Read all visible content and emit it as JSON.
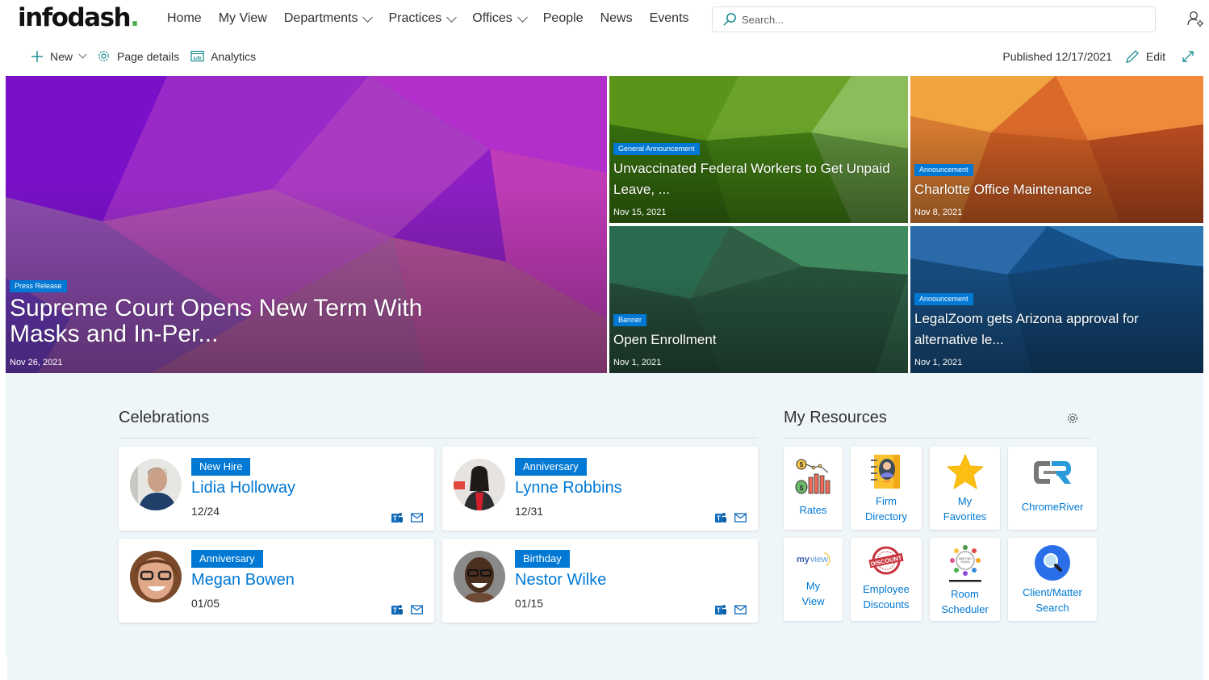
{
  "brand": {
    "logo_text": "infodash",
    "logo_dot": ".",
    "accent": "#4caf50"
  },
  "nav": {
    "items": [
      {
        "label": "Home",
        "dropdown": false
      },
      {
        "label": "My View",
        "dropdown": false
      },
      {
        "label": "Departments",
        "dropdown": true
      },
      {
        "label": "Practices",
        "dropdown": true
      },
      {
        "label": "Offices",
        "dropdown": true
      },
      {
        "label": "People",
        "dropdown": false
      },
      {
        "label": "News",
        "dropdown": false
      },
      {
        "label": "Events",
        "dropdown": false
      }
    ],
    "search_placeholder": "Search...",
    "user_icon": "person-settings-icon"
  },
  "commandbar": {
    "new_label": "New",
    "page_details_label": "Page details",
    "analytics_label": "Analytics",
    "published": "Published 12/17/2021",
    "edit_label": "Edit"
  },
  "hero": {
    "tiles": [
      {
        "badge": "Press Release",
        "title": "Supreme Court Opens New Term With Masks and In-Per...",
        "date": "Nov 26, 2021",
        "theme": "purple"
      },
      {
        "badge": "General Announcement",
        "title": "Unvaccinated Federal Workers to Get Unpaid Leave, ...",
        "date": "Nov 15, 2021",
        "theme": "green"
      },
      {
        "badge": "Announcement",
        "title": "Charlotte Office Maintenance",
        "date": "Nov 8, 2021",
        "theme": "orange"
      },
      {
        "badge": "Banner",
        "title": "Open Enrollment",
        "date": "Nov 1, 2021",
        "theme": "teal"
      },
      {
        "badge": "Announcement",
        "title": "LegalZoom gets Arizona approval for alternative le...",
        "date": "Nov 1, 2021",
        "theme": "blue"
      }
    ]
  },
  "celebrations": {
    "title": "Celebrations",
    "items": [
      {
        "type": "New Hire",
        "name": "Lidia Holloway",
        "date": "12/24"
      },
      {
        "type": "Anniversary",
        "name": "Lynne Robbins",
        "date": "12/31"
      },
      {
        "type": "Anniversary",
        "name": "Megan Bowen",
        "date": "01/05"
      },
      {
        "type": "Birthday",
        "name": "Nestor Wilke",
        "date": "01/15"
      }
    ]
  },
  "resources": {
    "title": "My Resources",
    "items": [
      {
        "label_1": "Rates",
        "label_2": "",
        "icon": "rates-chart-icon"
      },
      {
        "label_1": "Firm",
        "label_2": "Directory",
        "icon": "directory-book-icon"
      },
      {
        "label_1": "My",
        "label_2": "Favorites",
        "icon": "star-icon"
      },
      {
        "label_1": "ChromeRiver",
        "label_2": "",
        "icon": "chromeriver-logo-icon"
      },
      {
        "label_1": "My",
        "label_2": "View",
        "icon": "myview-logo-icon"
      },
      {
        "label_1": "Employee",
        "label_2": "Discounts",
        "icon": "discount-stamp-icon"
      },
      {
        "label_1": "Room",
        "label_2": "Scheduler",
        "icon": "meeting-room-icon"
      },
      {
        "label_1": "Client/Matter",
        "label_2": "Search",
        "icon": "magnifier-icon"
      }
    ]
  },
  "colors": {
    "badge": "#0078d4",
    "link": "#0078d4",
    "section_bg": "#eff6f9"
  }
}
